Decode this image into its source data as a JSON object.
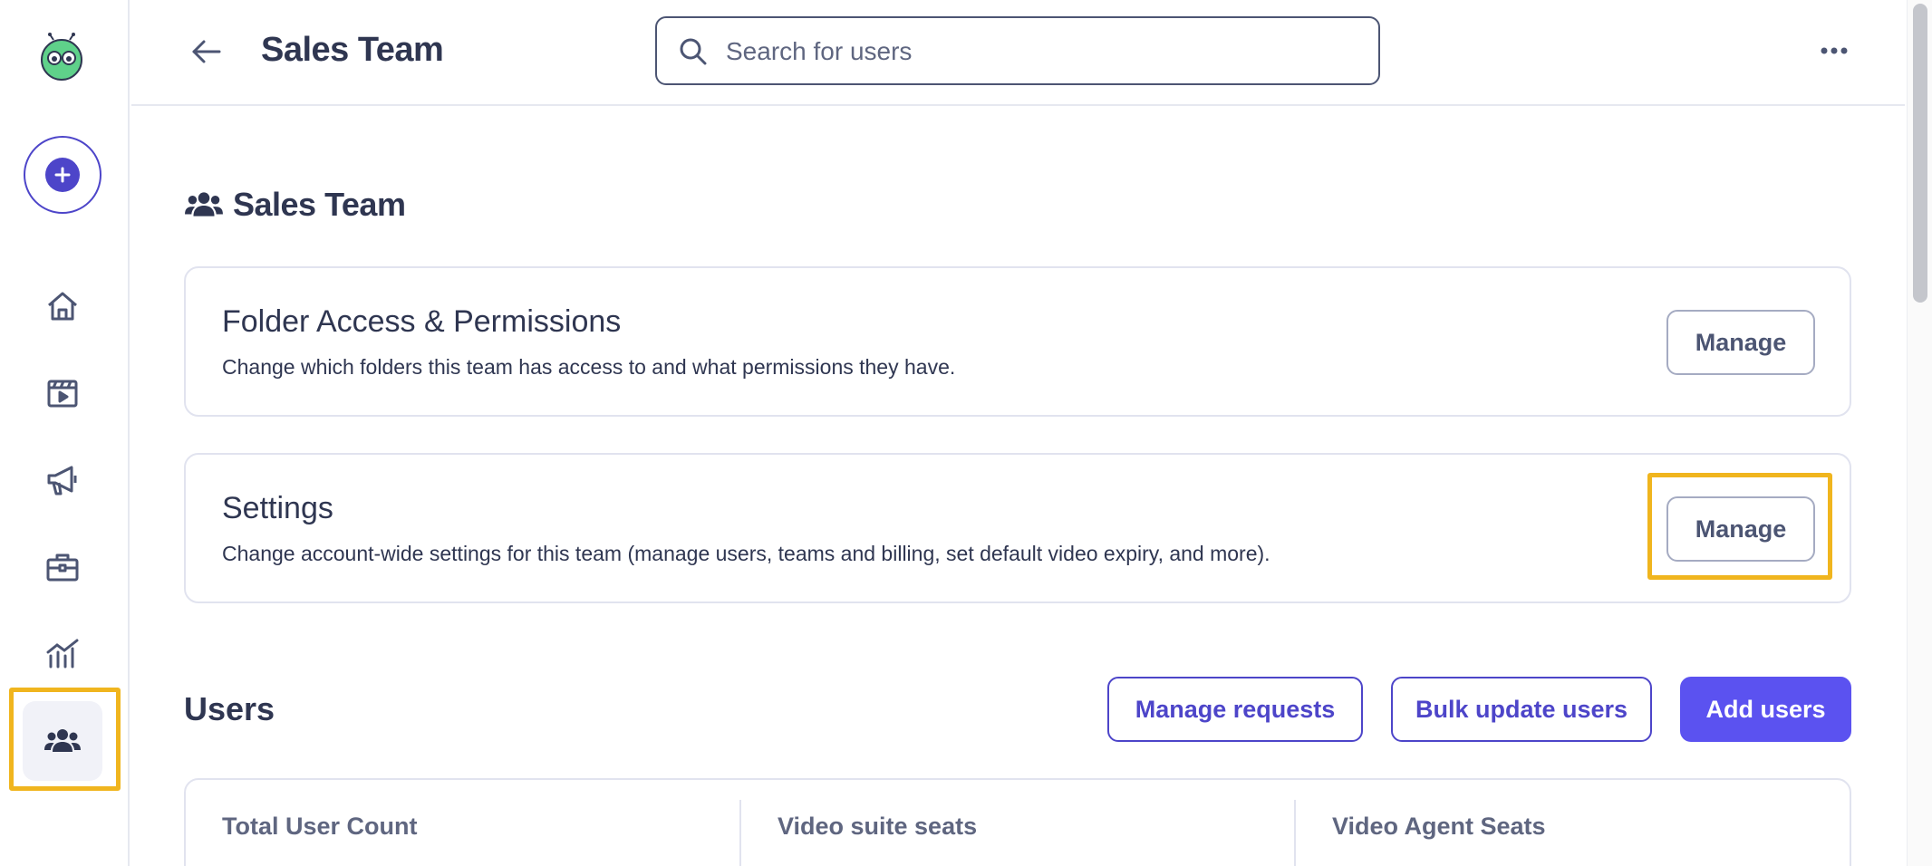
{
  "header": {
    "title": "Sales Team",
    "search_placeholder": "Search for users"
  },
  "sidebar": {
    "items": [
      {
        "name": "home",
        "icon": "home-icon"
      },
      {
        "name": "videos",
        "icon": "video-clapper-icon"
      },
      {
        "name": "campaigns",
        "icon": "megaphone-icon"
      },
      {
        "name": "business",
        "icon": "briefcase-icon"
      },
      {
        "name": "insights",
        "icon": "bar-chart-icon"
      },
      {
        "name": "teams",
        "icon": "users-icon",
        "active": true
      }
    ]
  },
  "main": {
    "heading": "Sales Team",
    "cards": [
      {
        "title": "Folder Access & Permissions",
        "description": "Change which folders this team has access to and what permissions they have.",
        "button": "Manage"
      },
      {
        "title": "Settings",
        "description": "Change account-wide settings for this team (manage users, teams and billing, set default video expiry, and more).",
        "button": "Manage"
      }
    ],
    "users": {
      "title": "Users",
      "manage_requests": "Manage requests",
      "bulk_update": "Bulk update users",
      "add_users": "Add users",
      "stats": [
        "Total User Count",
        "Video suite seats",
        "Video Agent Seats"
      ]
    }
  },
  "colors": {
    "primary": "#5b52f0",
    "accent": "#4d45c9",
    "text": "#2f3651",
    "highlight": "#f0b51e"
  }
}
